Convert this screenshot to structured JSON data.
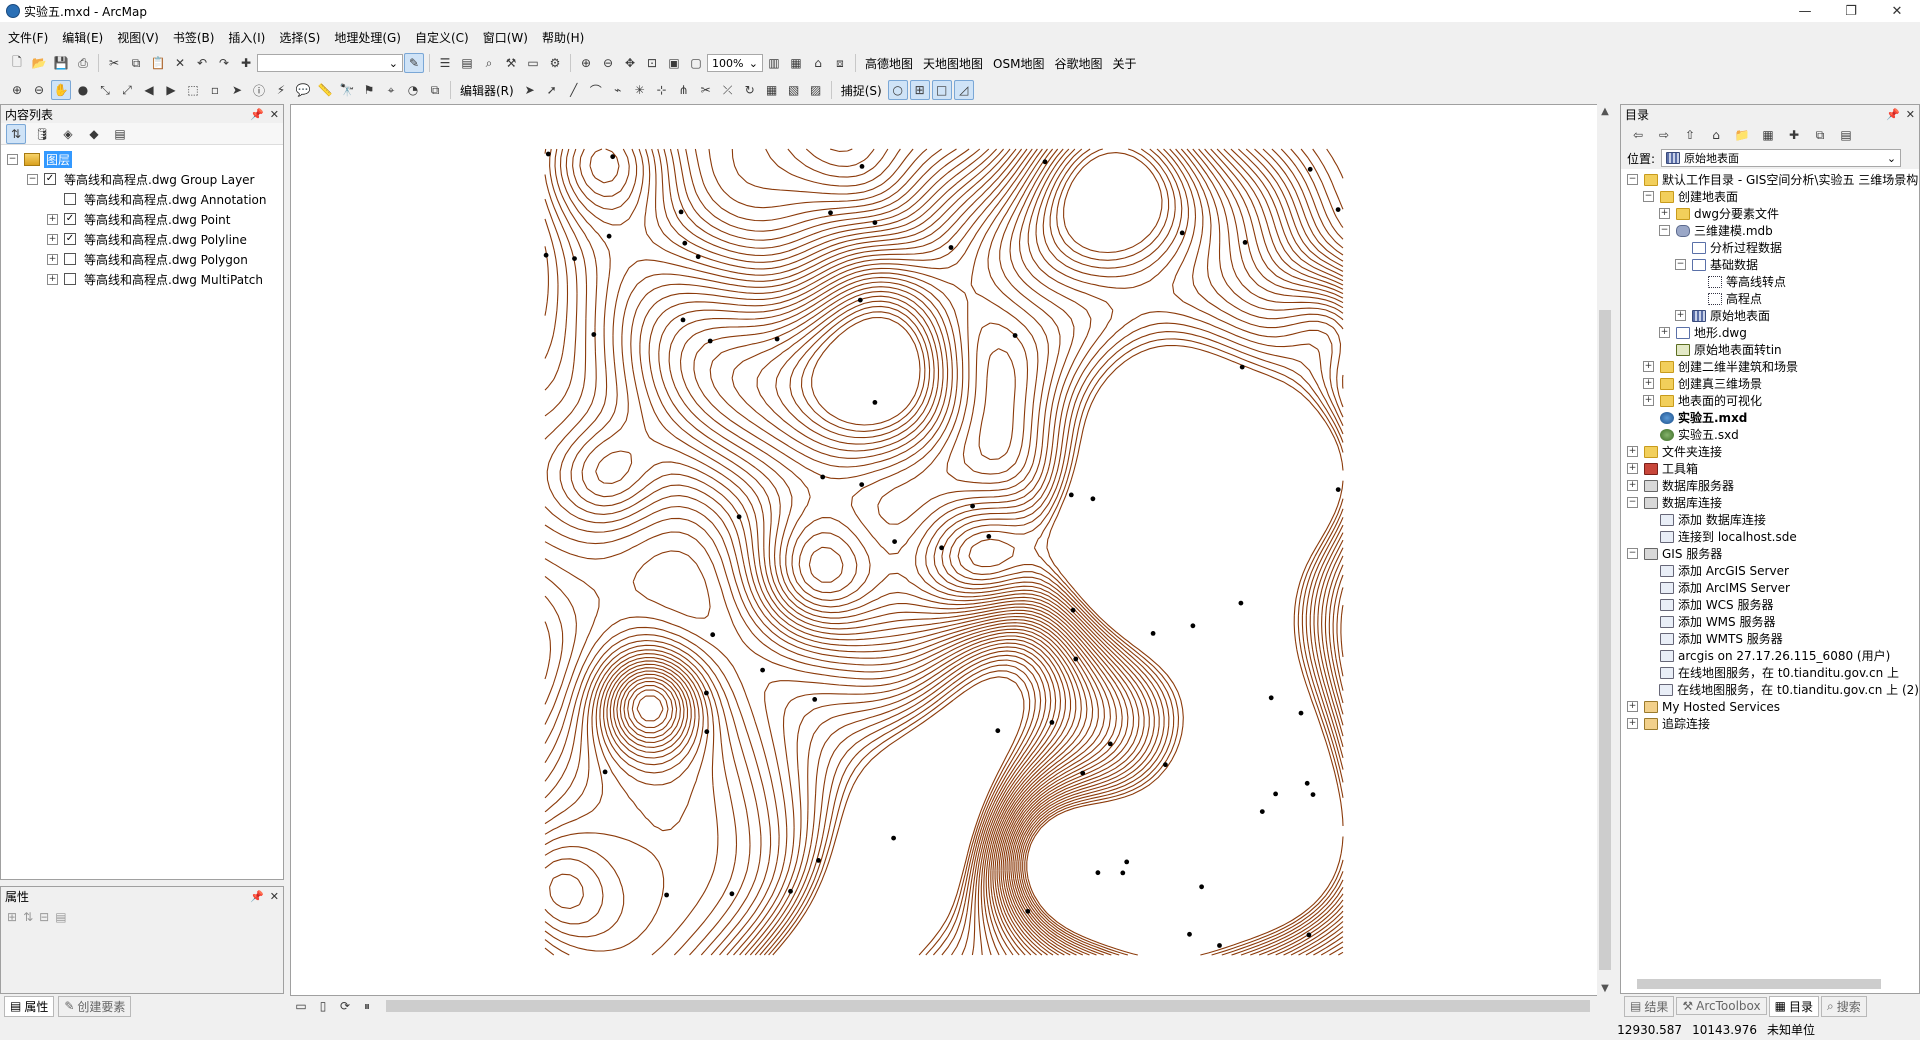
{
  "window": {
    "title": "实验五.mxd - ArcMap",
    "minimize": "—",
    "maximize": "❐",
    "close": "✕"
  },
  "menu": [
    "文件(F)",
    "编辑(E)",
    "视图(V)",
    "书签(B)",
    "插入(I)",
    "选择(S)",
    "地理处理(G)",
    "自定义(C)",
    "窗口(W)",
    "帮助(H)"
  ],
  "toolbar1": {
    "scale_value": "",
    "zoom_value": "100%",
    "plugin_menus": [
      "高德地图",
      "天地图地图",
      "OSM地图",
      "谷歌地图",
      "关于"
    ]
  },
  "toolbar2": {
    "editor_label": "编辑器(R)",
    "snap_label": "捕捉(S)"
  },
  "toc": {
    "title": "内容列表",
    "root_label": "图层",
    "group": {
      "label": "等高线和高程点.dwg Group Layer",
      "checked": true
    },
    "layers": [
      {
        "label": "等高线和高程点.dwg Annotation",
        "checked": false,
        "expandable": false
      },
      {
        "label": "等高线和高程点.dwg Point",
        "checked": true,
        "expandable": true
      },
      {
        "label": "等高线和高程点.dwg Polyline",
        "checked": true,
        "expandable": true
      },
      {
        "label": "等高线和高程点.dwg Polygon",
        "checked": false,
        "expandable": true
      },
      {
        "label": "等高线和高程点.dwg MultiPatch",
        "checked": false,
        "expandable": true
      }
    ]
  },
  "properties": {
    "title": "属性"
  },
  "left_tabs": [
    "属性",
    "创建要素"
  ],
  "map": {
    "contour_color": "#8b3a0a",
    "point_color": "#000000",
    "background": "#ffffff"
  },
  "catalog": {
    "title": "目录",
    "location_label": "位置:",
    "location_value": "原始地表面",
    "tree": [
      {
        "level": 0,
        "exp": "⊟",
        "icon": "folder",
        "label": "默认工作目录 - GIS空间分析\\实验五 三维场景构"
      },
      {
        "level": 1,
        "exp": "⊟",
        "icon": "folder",
        "label": "创建地表面"
      },
      {
        "level": 2,
        "exp": "⊞",
        "icon": "folder",
        "label": "dwg分要素文件"
      },
      {
        "level": 2,
        "exp": "⊟",
        "icon": "gdb",
        "label": "三维建模.mdb"
      },
      {
        "level": 3,
        "exp": "",
        "icon": "fds",
        "label": "分析过程数据"
      },
      {
        "level": 3,
        "exp": "⊟",
        "icon": "fds",
        "label": "基础数据"
      },
      {
        "level": 4,
        "exp": "",
        "icon": "pts",
        "label": "等高线转点"
      },
      {
        "level": 4,
        "exp": "",
        "icon": "pts",
        "label": "高程点"
      },
      {
        "level": 3,
        "exp": "⊞",
        "icon": "raster",
        "label": "原始地表面"
      },
      {
        "level": 2,
        "exp": "⊞",
        "icon": "fds",
        "label": "地形.dwg"
      },
      {
        "level": 2,
        "exp": "",
        "icon": "tin",
        "label": "原始地表面转tin"
      },
      {
        "level": 1,
        "exp": "⊞",
        "icon": "folder",
        "label": "创建二维半建筑和场景"
      },
      {
        "level": 1,
        "exp": "⊞",
        "icon": "folder",
        "label": "创建真三维场景"
      },
      {
        "level": 1,
        "exp": "⊞",
        "icon": "folder",
        "label": "地表面的可视化"
      },
      {
        "level": 1,
        "exp": "",
        "icon": "globe",
        "label": "实验五.mxd",
        "bold": true
      },
      {
        "level": 1,
        "exp": "",
        "icon": "sxd",
        "label": "实验五.sxd"
      },
      {
        "level": 0,
        "exp": "⊞",
        "icon": "folder",
        "label": "文件夹连接"
      },
      {
        "level": 0,
        "exp": "⊞",
        "icon": "tools",
        "label": "工具箱"
      },
      {
        "level": 0,
        "exp": "⊞",
        "icon": "server",
        "label": "数据库服务器"
      },
      {
        "level": 0,
        "exp": "⊟",
        "icon": "server",
        "label": "数据库连接"
      },
      {
        "level": 1,
        "exp": "",
        "icon": "add",
        "label": "添加 数据库连接"
      },
      {
        "level": 1,
        "exp": "",
        "icon": "add",
        "label": "连接到 localhost.sde"
      },
      {
        "level": 0,
        "exp": "⊟",
        "icon": "server",
        "label": "GIS 服务器"
      },
      {
        "level": 1,
        "exp": "",
        "icon": "add",
        "label": "添加 ArcGIS Server"
      },
      {
        "level": 1,
        "exp": "",
        "icon": "add",
        "label": "添加 ArcIMS Server"
      },
      {
        "level": 1,
        "exp": "",
        "icon": "add",
        "label": "添加 WCS 服务器"
      },
      {
        "level": 1,
        "exp": "",
        "icon": "add",
        "label": "添加 WMS 服务器"
      },
      {
        "level": 1,
        "exp": "",
        "icon": "add",
        "label": "添加 WMTS 服务器"
      },
      {
        "level": 1,
        "exp": "",
        "icon": "add",
        "label": "arcgis on 27.17.26.115_6080 (用户)"
      },
      {
        "level": 1,
        "exp": "",
        "icon": "add",
        "label": "在线地图服务，在 t0.tianditu.gov.cn 上"
      },
      {
        "level": 1,
        "exp": "",
        "icon": "add",
        "label": "在线地图服务，在 t0.tianditu.gov.cn 上 (2)"
      },
      {
        "level": 0,
        "exp": "⊞",
        "icon": "cloud",
        "label": "My Hosted Services"
      },
      {
        "level": 0,
        "exp": "⊞",
        "icon": "cloud",
        "label": "追踪连接"
      }
    ]
  },
  "right_tabs": [
    "结果",
    "ArcToolbox",
    "目录",
    "搜索"
  ],
  "status": {
    "x": "12930.587",
    "y": "10143.976",
    "units": "未知单位"
  }
}
